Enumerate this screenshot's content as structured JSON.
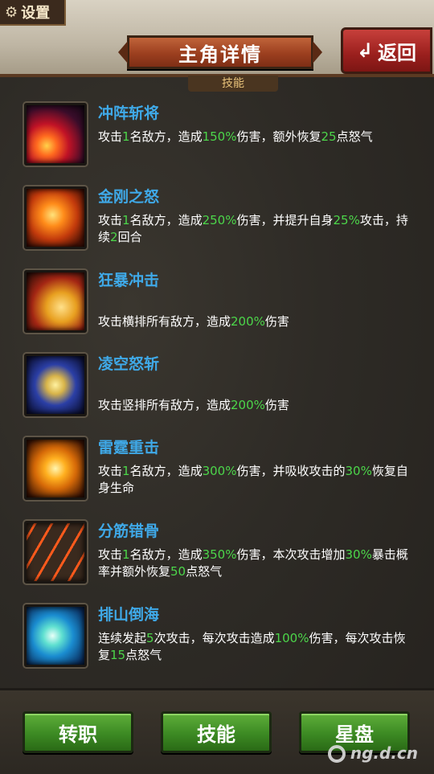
{
  "settings": {
    "label": "设置"
  },
  "header": {
    "title": "主角详情",
    "back_label": "返回",
    "section_tab": "技能"
  },
  "skills": [
    {
      "name": "冲阵斩将",
      "desc": [
        [
          "攻击",
          false
        ],
        [
          "1",
          true
        ],
        [
          "名敌方，造成",
          false
        ],
        [
          "150%",
          true
        ],
        [
          "伤害，额外恢复",
          false
        ],
        [
          "25",
          true
        ],
        [
          "点怒气",
          false
        ]
      ],
      "icon": "red-slash-icon"
    },
    {
      "name": "金刚之怒",
      "desc": [
        [
          "攻击",
          false
        ],
        [
          "1",
          true
        ],
        [
          "名敌方，造成",
          false
        ],
        [
          "250%",
          true
        ],
        [
          "伤害，并提升自身",
          false
        ],
        [
          "25%",
          true
        ],
        [
          "攻击，持续",
          false
        ],
        [
          "2",
          true
        ],
        [
          "回合",
          false
        ]
      ],
      "icon": "fire-fist-icon"
    },
    {
      "name": "狂暴冲击",
      "desc": [
        [
          "攻击横排所有敌方，造成",
          false
        ],
        [
          "200%",
          true
        ],
        [
          "伤害",
          false
        ]
      ],
      "icon": "axe-sweep-icon"
    },
    {
      "name": "凌空怒斩",
      "desc": [
        [
          "攻击竖排所有敌方，造成",
          false
        ],
        [
          "200%",
          true
        ],
        [
          "伤害",
          false
        ]
      ],
      "icon": "moon-blade-icon"
    },
    {
      "name": "雷霆重击",
      "desc": [
        [
          "攻击",
          false
        ],
        [
          "1",
          true
        ],
        [
          "名敌方，造成",
          false
        ],
        [
          "300%",
          true
        ],
        [
          "伤害，并吸收攻击的",
          false
        ],
        [
          "30%",
          true
        ],
        [
          "恢复自身生命",
          false
        ]
      ],
      "icon": "fire-orb-icon"
    },
    {
      "name": "分筋错骨",
      "desc": [
        [
          "攻击",
          false
        ],
        [
          "1",
          true
        ],
        [
          "名敌方，造成",
          false
        ],
        [
          "350%",
          true
        ],
        [
          "伤害，本次攻击增加",
          false
        ],
        [
          "30%",
          true
        ],
        [
          "暴击概率并额外恢复",
          false
        ],
        [
          "50",
          true
        ],
        [
          "点怒气",
          false
        ]
      ],
      "icon": "claw-slash-icon"
    },
    {
      "name": "排山倒海",
      "desc": [
        [
          "连续发起",
          false
        ],
        [
          "5",
          true
        ],
        [
          "次攻击，每次攻击造成",
          false
        ],
        [
          "100%",
          true
        ],
        [
          "伤害，每次攻击恢复",
          false
        ],
        [
          "15",
          true
        ],
        [
          "点怒气",
          false
        ]
      ],
      "icon": "water-vortex-icon"
    }
  ],
  "bottom_buttons": [
    "转职",
    "技能",
    "星盘"
  ],
  "watermark": "ng.d.cn",
  "colors": {
    "skill_name": "#3fa9e8",
    "highlight": "#4cd64a",
    "button_green": "#3c8a23",
    "back_red": "#9a1f1d"
  }
}
